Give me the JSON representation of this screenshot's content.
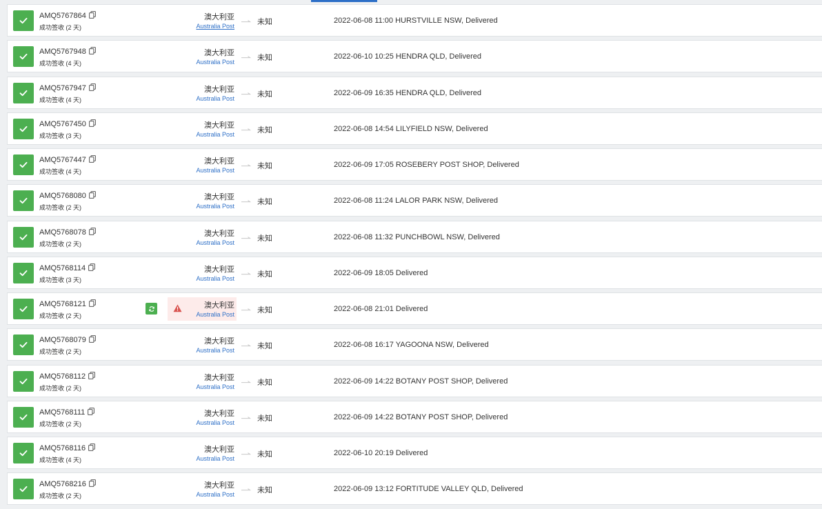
{
  "colors": {
    "accent": "#4caf50",
    "link": "#2d6fc7",
    "warning": "#d9534f",
    "warning_bg": "#fdebea"
  },
  "icons": {
    "check": "check-icon",
    "copy": "copy-icon",
    "sync": "sync-icon",
    "warning": "warning-icon",
    "arrow": "arrow-right-icon"
  },
  "shipments": [
    {
      "tracking": "AMQ5767864",
      "status": "成功签收 (2 天)",
      "origin": "澳大利亚",
      "carrier": "Australia Post",
      "destination": "未知",
      "event": "2022-06-08 11:00  HURSTVILLE NSW, Delivered",
      "warning": false
    },
    {
      "tracking": "AMQ5767948",
      "status": "成功签收 (4 天)",
      "origin": "澳大利亚",
      "carrier": "Australia Post",
      "destination": "未知",
      "event": "2022-06-10 10:25  HENDRA QLD, Delivered",
      "warning": false
    },
    {
      "tracking": "AMQ5767947",
      "status": "成功签收 (4 天)",
      "origin": "澳大利亚",
      "carrier": "Australia Post",
      "destination": "未知",
      "event": "2022-06-09 16:35  HENDRA QLD, Delivered",
      "warning": false
    },
    {
      "tracking": "AMQ5767450",
      "status": "成功签收 (3 天)",
      "origin": "澳大利亚",
      "carrier": "Australia Post",
      "destination": "未知",
      "event": "2022-06-08 14:54  LILYFIELD NSW, Delivered",
      "warning": false
    },
    {
      "tracking": "AMQ5767447",
      "status": "成功签收 (4 天)",
      "origin": "澳大利亚",
      "carrier": "Australia Post",
      "destination": "未知",
      "event": "2022-06-09 17:05  ROSEBERY POST SHOP, Delivered",
      "warning": false
    },
    {
      "tracking": "AMQ5768080",
      "status": "成功签收 (2 天)",
      "origin": "澳大利亚",
      "carrier": "Australia Post",
      "destination": "未知",
      "event": "2022-06-08 11:24  LALOR PARK NSW, Delivered",
      "warning": false
    },
    {
      "tracking": "AMQ5768078",
      "status": "成功签收 (2 天)",
      "origin": "澳大利亚",
      "carrier": "Australia Post",
      "destination": "未知",
      "event": "2022-06-08 11:32  PUNCHBOWL NSW, Delivered",
      "warning": false
    },
    {
      "tracking": "AMQ5768114",
      "status": "成功签收 (3 天)",
      "origin": "澳大利亚",
      "carrier": "Australia Post",
      "destination": "未知",
      "event": "2022-06-09 18:05  Delivered",
      "warning": false
    },
    {
      "tracking": "AMQ5768121",
      "status": "成功签收 (2 天)",
      "origin": "澳大利亚",
      "carrier": "Australia Post",
      "destination": "未知",
      "event": "2022-06-08 21:01  Delivered",
      "warning": true
    },
    {
      "tracking": "AMQ5768079",
      "status": "成功签收 (2 天)",
      "origin": "澳大利亚",
      "carrier": "Australia Post",
      "destination": "未知",
      "event": "2022-06-08 16:17  YAGOONA NSW, Delivered",
      "warning": false
    },
    {
      "tracking": "AMQ5768112",
      "status": "成功签收 (2 天)",
      "origin": "澳大利亚",
      "carrier": "Australia Post",
      "destination": "未知",
      "event": "2022-06-09 14:22  BOTANY POST SHOP, Delivered",
      "warning": false
    },
    {
      "tracking": "AMQ5768111",
      "status": "成功签收 (2 天)",
      "origin": "澳大利亚",
      "carrier": "Australia Post",
      "destination": "未知",
      "event": "2022-06-09 14:22  BOTANY POST SHOP, Delivered",
      "warning": false
    },
    {
      "tracking": "AMQ5768116",
      "status": "成功签收 (4 天)",
      "origin": "澳大利亚",
      "carrier": "Australia Post",
      "destination": "未知",
      "event": "2022-06-10 20:19  Delivered",
      "warning": false
    },
    {
      "tracking": "AMQ5768216",
      "status": "成功签收 (2 天)",
      "origin": "澳大利亚",
      "carrier": "Australia Post",
      "destination": "未知",
      "event": "2022-06-09 13:12  FORTITUDE VALLEY QLD, Delivered",
      "warning": false
    }
  ]
}
